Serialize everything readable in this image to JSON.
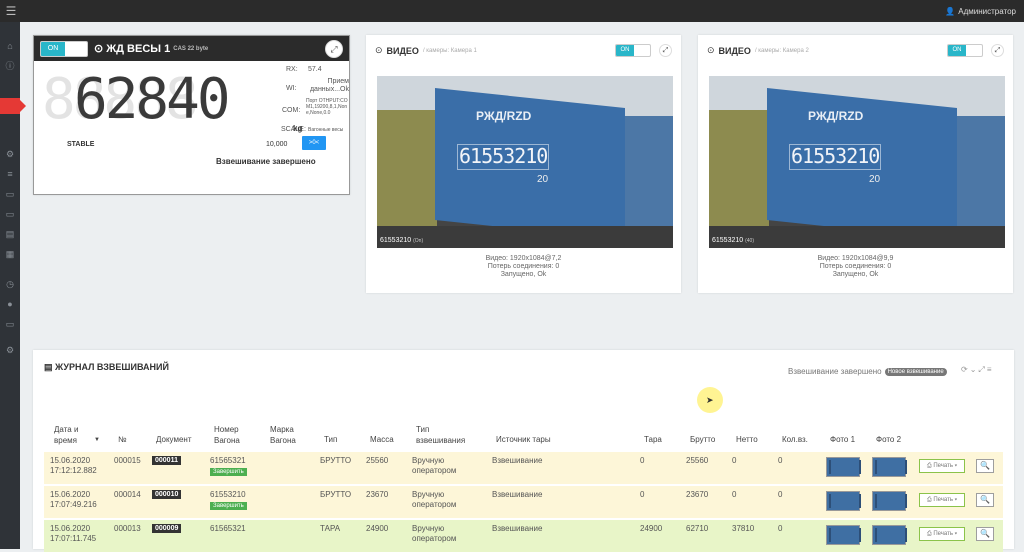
{
  "topbar": {
    "user": "Администратор"
  },
  "scale": {
    "toggle": "ON",
    "title": "ЖД ВЕСЫ 1",
    "subtitle": "CAS 22 byte",
    "background_digits": "88888",
    "weight": "62840",
    "unit": "kg",
    "stable": "STABLE",
    "capacity": "10,000",
    "zero_button": ">0<",
    "status": "Взвешивание завершено",
    "rx_label": "RX:",
    "rx_value": "57.4",
    "wi_label": "WI:",
    "wi_value": "Прием данных...Ok",
    "com_label": "COM:",
    "com_value": "Порт OTHPUT:COM1,19200,8,1,None,None,0.0",
    "scale_label": "SCALE:",
    "scale_value": "Вагонные весы"
  },
  "videos": [
    {
      "title": "ВИДЕО",
      "subtitle": "/ камеры: Камера 1",
      "toggle": "ON",
      "plate": "61553210",
      "overlay": "61553210",
      "overlay_small": "(On)",
      "rzd": "РЖД/RZD",
      "number_20": "20",
      "line1": "Видео: 1920x1084@7,2",
      "line2": "Потерь соединения: 0",
      "line3": "Запущено, Ok"
    },
    {
      "title": "ВИДЕО",
      "subtitle": "/ камеры: Камера 2",
      "toggle": "ON",
      "plate": "61553210",
      "overlay": "61553210",
      "overlay_small": "(40)",
      "rzd": "РЖД/RZD",
      "number_20": "20",
      "line1": "Видео: 1920x1084@9,9",
      "line2": "Потерь соединения: 0",
      "line3": "Запущено, Ok"
    }
  ],
  "journal": {
    "title": "ЖУРНАЛ ВЗВЕШИВАНИЙ",
    "status": "Взвешивание завершено",
    "badge": "Новое взвешивание",
    "columns": [
      "Дата и время",
      "№",
      "Документ",
      "Номер Вагона",
      "Марка Вагона",
      "Тип",
      "Масса",
      "Тип взвешивания",
      "Источник тары",
      "Тара",
      "Брутто",
      "Нетто",
      "Кол.вз.",
      "Фото 1",
      "Фото 2"
    ],
    "rows": [
      {
        "date": "15.06.2020",
        "time": "17:12:12.882",
        "num": "000015",
        "doc": "000011",
        "wagon": "61565321",
        "badge": "Завершить",
        "type": "БРУТТО",
        "mass": "25560",
        "wtype1": "Вручную",
        "wtype2": "оператором",
        "source": "Взвешивание",
        "tara": "0",
        "brutto": "25560",
        "netto": "0",
        "count": "0",
        "print": "Печать"
      },
      {
        "date": "15.06.2020",
        "time": "17:07:49.216",
        "num": "000014",
        "doc": "000010",
        "wagon": "61553210",
        "badge": "Завершить",
        "type": "БРУТТО",
        "mass": "23670",
        "wtype1": "Вручную",
        "wtype2": "оператором",
        "source": "Взвешивание",
        "tara": "0",
        "brutto": "23670",
        "netto": "0",
        "count": "0",
        "print": "Печать"
      },
      {
        "date": "15.06.2020",
        "time": "17:07:11.745",
        "num": "000013",
        "doc": "000009",
        "wagon": "61565321",
        "badge": "",
        "type": "ТАРА",
        "mass": "24900",
        "wtype1": "Вручную",
        "wtype2": "оператором",
        "source": "Взвешивание",
        "tara": "24900",
        "brutto": "62710",
        "netto": "37810",
        "count": "0",
        "print": "Печать"
      }
    ]
  }
}
